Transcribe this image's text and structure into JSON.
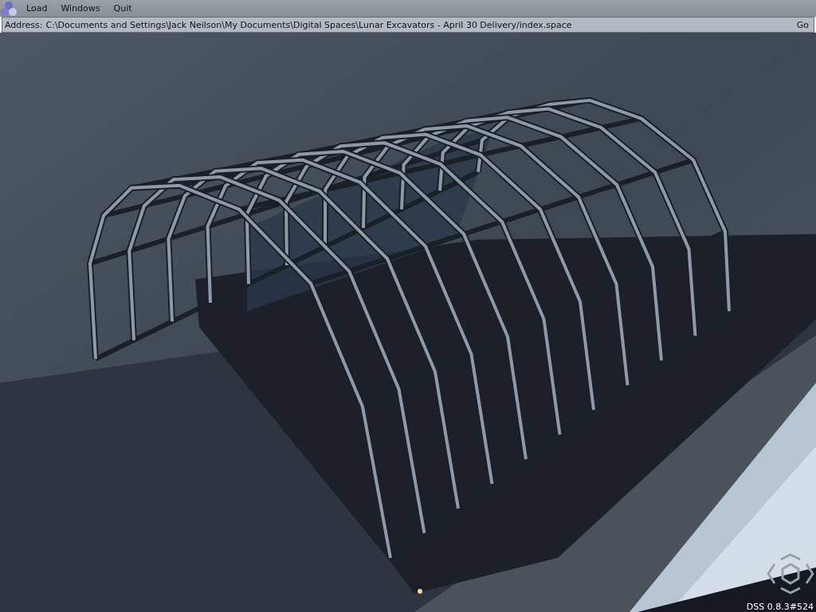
{
  "menu": [
    {
      "label": "Load"
    },
    {
      "label": "Windows"
    },
    {
      "label": "Quit"
    }
  ],
  "address_bar": {
    "label": "Address:",
    "value": "C:\\Documents and Settings\\Jack Neilson\\My Documents\\Digital Spaces\\Lunar Excavators - April 30 Delivery/index.space",
    "button": "Go"
  },
  "version": "DSS 0.8.3#524"
}
